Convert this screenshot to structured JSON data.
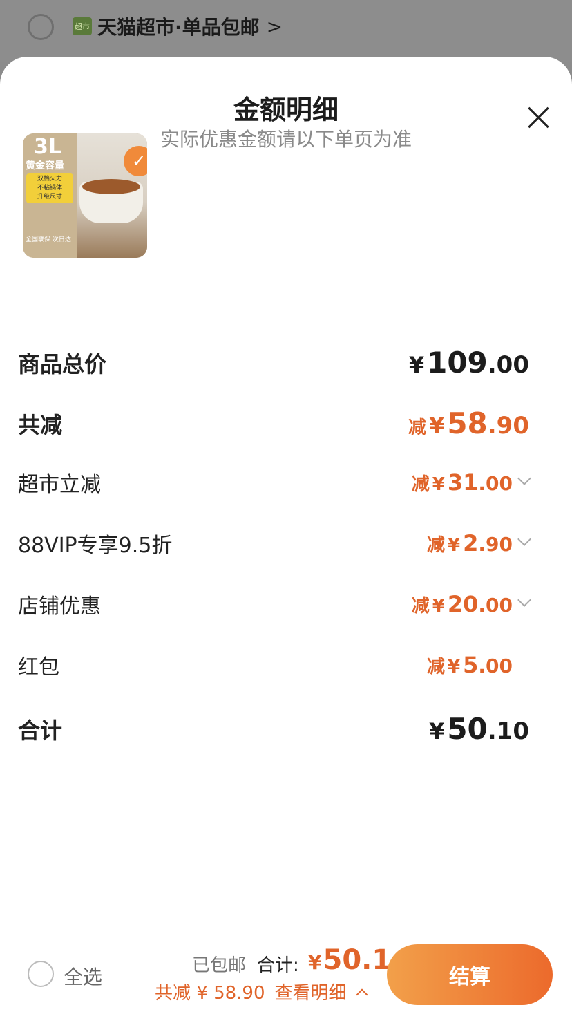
{
  "store_strip": {
    "logo_text": "超市",
    "name": "天猫超市·单品包邮",
    "chevron": ">"
  },
  "sheet": {
    "title": "金额明细",
    "subtitle": "实际优惠金额请以下单页为准"
  },
  "product": {
    "capacity": "3L",
    "tagline": "黄金容量",
    "features": [
      "双档火力",
      "不粘锅体",
      "升级尺寸"
    ],
    "badge": "全国联保 次日达",
    "selected": true
  },
  "rows": [
    {
      "label": "商品总价",
      "prefix": "",
      "yen": "¥",
      "int": "109",
      "dec": ".00",
      "style": "total",
      "expandable": false
    },
    {
      "label": "共减",
      "prefix": "减",
      "yen": "¥",
      "int": "58",
      "dec": ".90",
      "style": "discount-total",
      "expandable": false
    },
    {
      "label": "超市立减",
      "prefix": "减",
      "yen": "¥",
      "int": "31",
      "dec": ".00",
      "style": "discount",
      "expandable": true
    },
    {
      "label": "88VIP专享9.5折",
      "prefix": "减",
      "yen": "¥",
      "int": "2",
      "dec": ".90",
      "style": "discount",
      "expandable": true
    },
    {
      "label": "店铺优惠",
      "prefix": "减",
      "yen": "¥",
      "int": "20",
      "dec": ".00",
      "style": "discount",
      "expandable": true
    },
    {
      "label": "红包",
      "prefix": "减",
      "yen": "¥",
      "int": "5",
      "dec": ".00",
      "style": "discount",
      "expandable": false
    },
    {
      "label": "合计",
      "prefix": "",
      "yen": "¥",
      "int": "50",
      "dec": ".10",
      "style": "total",
      "expandable": false
    }
  ],
  "bottom_bar": {
    "select_all": "全选",
    "shipped": "已包邮",
    "total_label": "合计:",
    "total_yen": "¥",
    "total_value": "50.1",
    "discount_text": "共减 ¥ 58.90",
    "view_detail": "查看明细",
    "checkout": "结算"
  },
  "colors": {
    "accent": "#e0642a",
    "checkout_gradient_start": "#f2a04a",
    "checkout_gradient_end": "#ec6a2c"
  }
}
